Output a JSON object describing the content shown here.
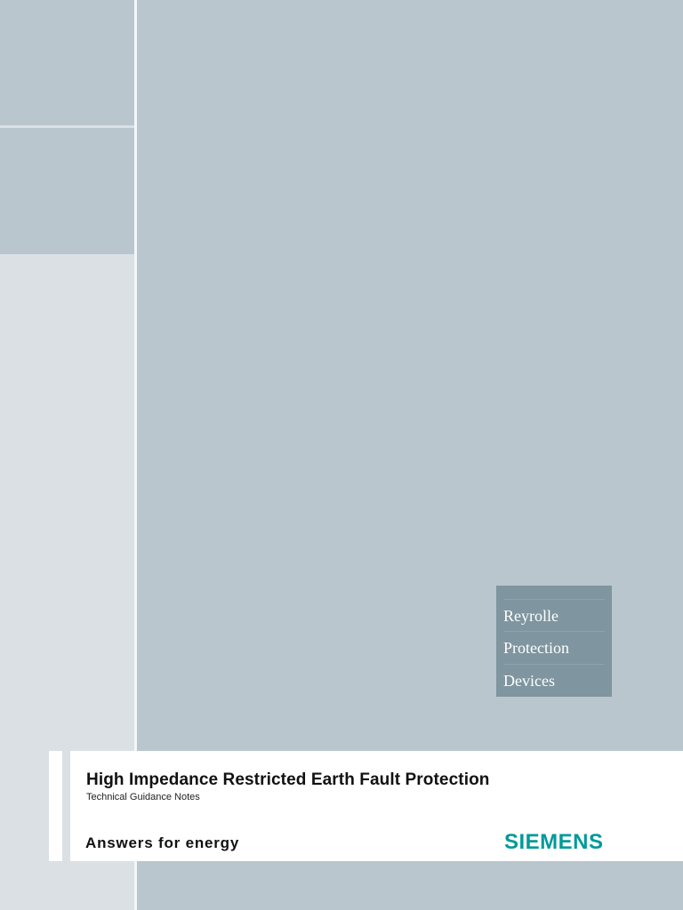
{
  "sidebar_box": {
    "lines": [
      "Reyrolle",
      "Protection",
      "Devices"
    ]
  },
  "cover": {
    "title": "High Impedance Restricted Earth Fault Protection",
    "subtitle": "Technical Guidance Notes",
    "tagline": "Answers for energy",
    "brand": "SIEMENS"
  },
  "colors": {
    "background": "#b9c6cd",
    "left_column": "#dbe0e5",
    "box": "#7f959f",
    "brand": "#009999"
  }
}
